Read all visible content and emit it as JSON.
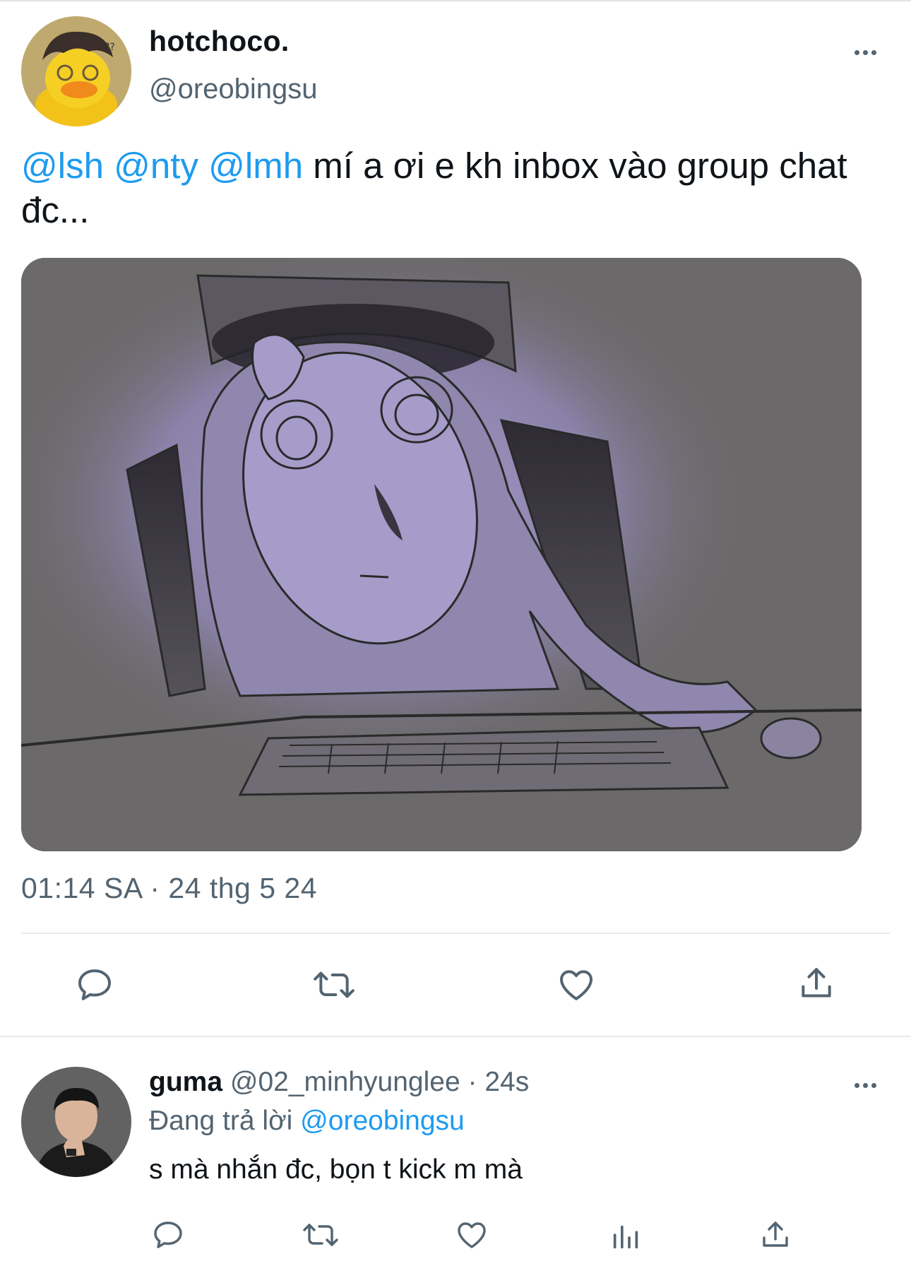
{
  "tweet": {
    "display_name": "hotchoco.",
    "handle": "@oreobingsu",
    "mentions": [
      "@lsh",
      "@nty",
      "@lmh"
    ],
    "text_rest": " mí a ơi e kh inbox vào group chat đc...",
    "timestamp": "01:14 SA · 24 thg 5 24",
    "actions": [
      "reply-icon",
      "retweet-icon",
      "like-icon",
      "share-icon"
    ]
  },
  "reply": {
    "display_name": "guma",
    "handle": "@02_minhyunglee",
    "separator": " · ",
    "time": "24s",
    "replying_prefix": "Đang trả lời ",
    "replying_to": "@oreobingsu",
    "text": "s mà nhắn đc, bọn t kick m mà",
    "actions": [
      "reply-icon",
      "retweet-icon",
      "like-icon",
      "views-icon",
      "share-icon"
    ]
  },
  "colors": {
    "accent": "#1d9bf0",
    "secondary_text": "#536471",
    "primary_text": "#0f1419"
  }
}
